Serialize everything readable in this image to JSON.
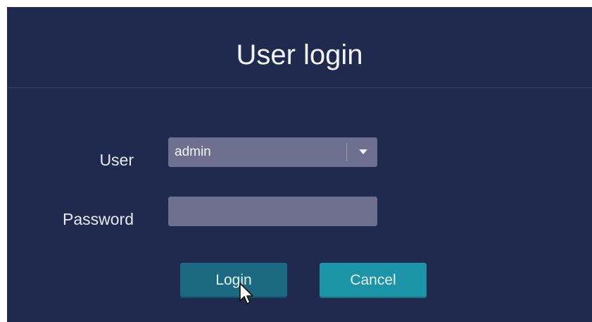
{
  "dialog": {
    "title": "User login"
  },
  "form": {
    "user_label": "User",
    "user_value": "admin",
    "password_label": "Password",
    "password_value": ""
  },
  "buttons": {
    "login_label": "Login",
    "cancel_label": "Cancel"
  },
  "colors": {
    "background": "#1f2a4e",
    "field": "#6c6f8f",
    "login_button": "#1b6a82",
    "cancel_button": "#1a94a6"
  },
  "icons": {
    "dropdown": "chevron-down-icon",
    "pointer": "mouse-cursor-icon"
  }
}
